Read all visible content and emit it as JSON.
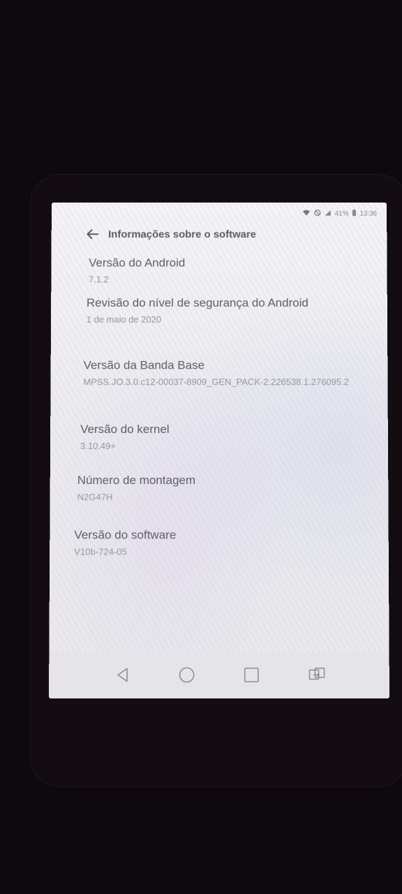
{
  "status_bar": {
    "battery": "41%",
    "time": "13:36"
  },
  "app_bar": {
    "title": "Informações sobre o software"
  },
  "items": [
    {
      "title": "Versão do Android",
      "value": "7.1.2"
    },
    {
      "title": "Revisão do nível de segurança do Android",
      "value": "1 de maio de 2020"
    },
    {
      "title": "Versão da Banda Base",
      "value": "MPSS.JO.3.0.c12-00037-8909_GEN_PACK-2.226538.1.276095.2"
    },
    {
      "title": "Versão do kernel",
      "value": "3.10.49+"
    },
    {
      "title": "Número de montagem",
      "value": "N2G47H"
    },
    {
      "title": "Versão do software",
      "value": "V10b-724-05"
    }
  ],
  "nav_bar": {
    "icons": [
      "back-icon",
      "home-icon",
      "recents-icon",
      "dual-window-icon"
    ]
  },
  "colors": {
    "screen_bg": "#efeef2",
    "title_text": "#5f5e66",
    "value_text": "#97959e",
    "outer_bg": "#0e090d"
  }
}
